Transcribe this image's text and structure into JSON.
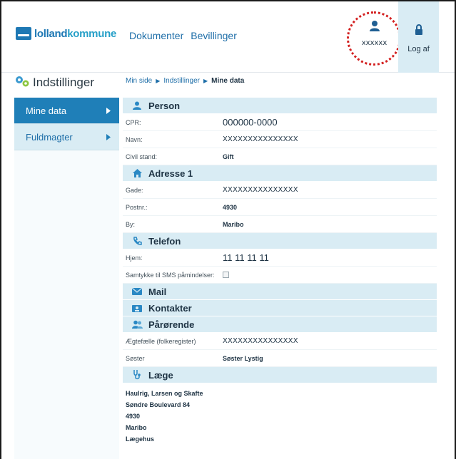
{
  "header": {
    "logo_text_a": "lolland",
    "logo_text_b": "kommune",
    "nav": [
      "Dokumenter",
      "Bevillinger"
    ],
    "user_name": "xxxxxx",
    "logout_label": "Log af"
  },
  "sidebar": {
    "title": "Indstillinger",
    "items": [
      {
        "label": "Mine data",
        "active": true
      },
      {
        "label": "Fuldmagter",
        "active": false
      }
    ]
  },
  "breadcrumb": [
    "Min side",
    "Indstillinger",
    "Mine data"
  ],
  "sections": {
    "person": {
      "title": "Person",
      "rows": [
        {
          "label": "CPR:",
          "value": "000000-0000"
        },
        {
          "label": "Navn:",
          "value": "XXXXXXXXXXXXXXX"
        },
        {
          "label": "Civil stand:",
          "value": "Gift"
        }
      ]
    },
    "adresse": {
      "title": "Adresse 1",
      "rows": [
        {
          "label": "Gade:",
          "value": "XXXXXXXXXXXXXXX"
        },
        {
          "label": "Postnr.:",
          "value": "4930"
        },
        {
          "label": "By:",
          "value": "Maribo"
        }
      ]
    },
    "telefon": {
      "title": "Telefon",
      "rows": [
        {
          "label": "Hjem:",
          "value": "11 11 11 11"
        },
        {
          "label": "Samtykke til SMS påmindelser:",
          "value": ""
        }
      ]
    },
    "mail": {
      "title": "Mail"
    },
    "kontakter": {
      "title": "Kontakter"
    },
    "paarorende": {
      "title": "Pårørende",
      "rows": [
        {
          "label": "Ægtefælle (folkeregister)",
          "value": "XXXXXXXXXXXXXXX"
        },
        {
          "label": "Søster",
          "value": "Søster Lystig"
        }
      ]
    },
    "laege": {
      "title": "Læge",
      "lines": [
        "Haulrig, Larsen og Skafte",
        "Søndre Boulevard 84",
        "4930",
        "Maribo",
        "Lægehus"
      ]
    }
  },
  "colors": {
    "accent": "#1f7fb8",
    "section_bg": "#d9ecf4",
    "annotation_ring": "#d32020"
  }
}
